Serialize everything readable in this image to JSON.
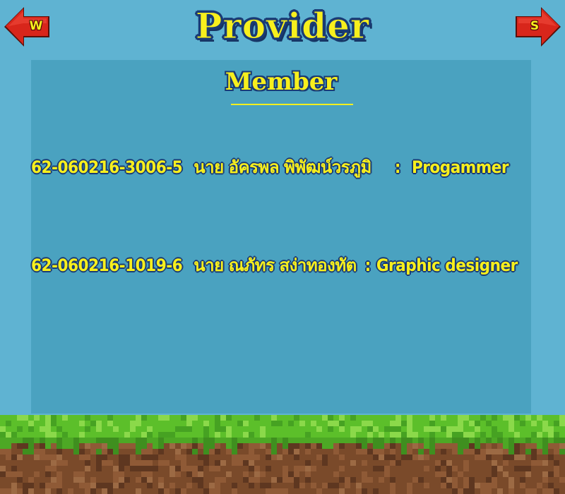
{
  "header": {
    "title": "Provider",
    "left_button_label": "W",
    "right_button_label": "S"
  },
  "panel": {
    "subtitle": "Member",
    "members": [
      {
        "id": "62-060216-3006-5",
        "name": "นาย อัครพล  พิพัฒน์วรภูมิ",
        "separator": ":",
        "role": "Progammer"
      },
      {
        "id": "62-060216-1019-6",
        "name": "นาย ณภัทร   สง่าทองทัต",
        "separator": ":",
        "role": "Graphic designer"
      }
    ]
  },
  "colors": {
    "background": "#5fb3d2",
    "panel": "#4aa2c0",
    "text_yellow": "#f7ef1d",
    "text_outline": "#1a3b74",
    "arrow_red": "#d8261b",
    "grass": "#5cbf2a",
    "dirt": "#7a4a2a"
  },
  "icons": {
    "left": "red-arrow-left-icon",
    "right": "red-arrow-right-icon"
  }
}
